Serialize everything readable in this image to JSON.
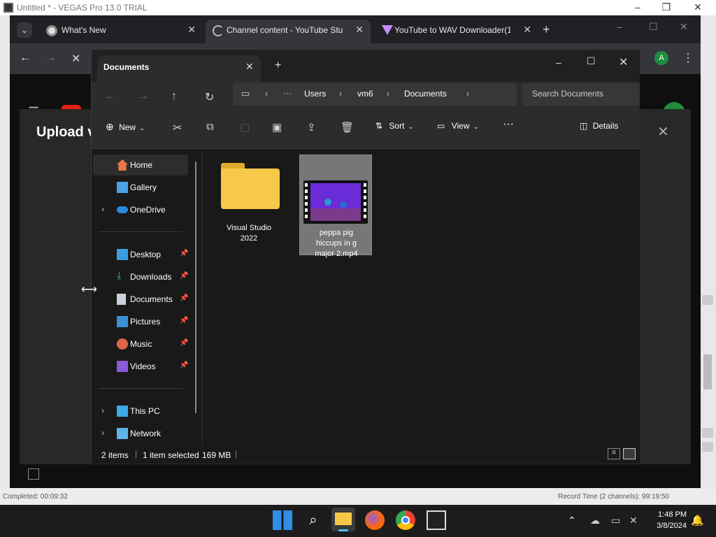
{
  "vegas": {
    "title": "Untitled * - VEGAS Pro 13.0 TRIAL",
    "status_left": "Completed: 00:09:32",
    "status_right": "Record Time (2 channels): 99:19:50"
  },
  "chrome": {
    "tabs": [
      {
        "label": "What's New"
      },
      {
        "label": "Channel content - YouTube Stu"
      },
      {
        "label": "YouTube to WAV Downloader(1"
      }
    ],
    "new_tab": "+",
    "profile_initial": "A",
    "upload_title": "Upload v"
  },
  "explorer": {
    "tab_title": "Documents",
    "breadcrumb": [
      "Users",
      "vm6",
      "Documents"
    ],
    "search_placeholder": "Search Documents",
    "cmd": {
      "new": "New",
      "sort": "Sort",
      "view": "View",
      "details": "Details"
    },
    "nav": {
      "home": "Home",
      "gallery": "Gallery",
      "onedrive": "OneDrive",
      "desktop": "Desktop",
      "downloads": "Downloads",
      "documents": "Documents",
      "pictures": "Pictures",
      "music": "Music",
      "videos": "Videos",
      "this_pc": "This PC",
      "network": "Network"
    },
    "files": [
      {
        "name_line1": "Visual Studio",
        "name_line2": "2022"
      },
      {
        "name_line1": "peppa pig",
        "name_line2": "hiccups in g",
        "name_line3": "major 2.mp4"
      }
    ],
    "status": {
      "count": "2 items",
      "selected": "1 item selected",
      "size": "169 MB"
    }
  },
  "taskbar": {
    "time": "1:48 PM",
    "date": "3/8/2024"
  },
  "colors": {
    "folder": "#f7c948",
    "video_bg": "#6a2bd8",
    "selected": "#777777",
    "accent": "#4cc2ff"
  }
}
